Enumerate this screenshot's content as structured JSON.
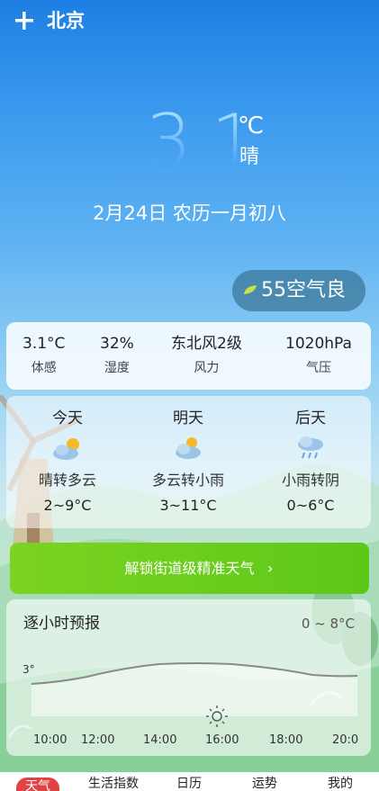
{
  "header": {
    "add_icon": "plus-icon",
    "city": "北京"
  },
  "current": {
    "temperature": "3.1",
    "unit": "℃",
    "condition": "晴",
    "date": "2月24日 农历一月初八"
  },
  "aqi": {
    "value": "55",
    "label": "空气良",
    "leaf_icon": "leaf-icon",
    "leaf_color": "#c6e04a"
  },
  "metrics": [
    {
      "value": "3.1°C",
      "label": "体感"
    },
    {
      "value": "32%",
      "label": "湿度"
    },
    {
      "value": "东北风2级",
      "label": "风力"
    },
    {
      "value": "1020hPa",
      "label": "气压"
    }
  ],
  "forecast": [
    {
      "day": "今天",
      "icon": "sun-behind-cloud-icon",
      "condition": "晴转多云",
      "range": "2~9°C"
    },
    {
      "day": "明天",
      "icon": "cloud-sun-icon",
      "condition": "多云转小雨",
      "range": "3~11°C"
    },
    {
      "day": "后天",
      "icon": "rain-cloud-icon",
      "condition": "小雨转阴",
      "range": "0~6°C"
    }
  ],
  "unlock": {
    "label": "解锁街道级精准天气",
    "arrow": "›",
    "color": "#6cce1e"
  },
  "hourly": {
    "title": "逐小时预报",
    "range": "0 ~ 8°C",
    "first_temp_label": "3°",
    "times": [
      "10:00",
      "12:00",
      "14:00",
      "16:00",
      "18:00",
      "20:0"
    ],
    "sun_icon": "sun-icon"
  },
  "tabs": [
    {
      "label": "天气",
      "active": true
    },
    {
      "label": "生活指数",
      "active": false
    },
    {
      "label": "日历",
      "active": false
    },
    {
      "label": "运势",
      "active": false
    },
    {
      "label": "我的",
      "active": false
    }
  ],
  "colors": {
    "tab_active": "#e04343",
    "sky_top": "#1d7fe3"
  }
}
